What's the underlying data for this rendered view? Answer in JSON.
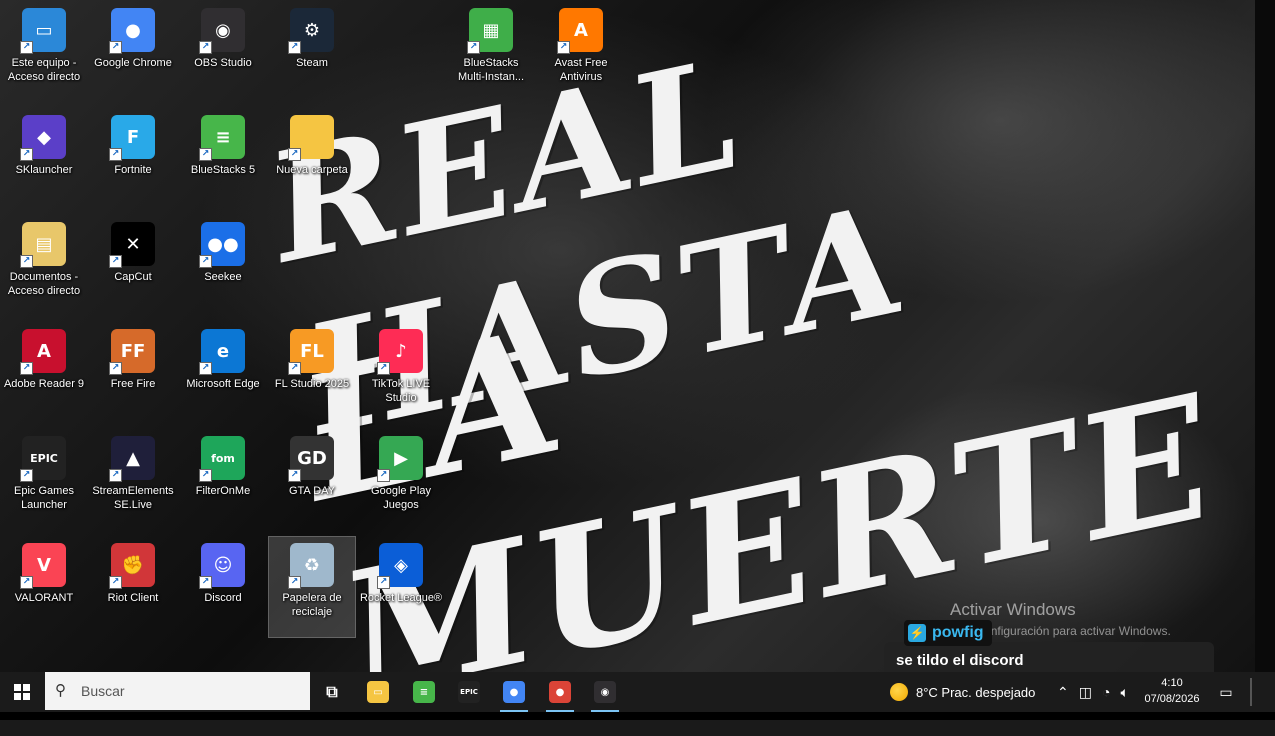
{
  "wallpaper": {
    "line1": "REAL HASTA",
    "line2": "LA MUERTE"
  },
  "desktop": {
    "icons": [
      {
        "label": "Este equipo -\nAcceso directo",
        "icon": "pc-icon",
        "bg": "#2b88d8",
        "glyph": "▭"
      },
      {
        "label": "Google Chrome",
        "icon": "chrome-icon",
        "bg": "#4285f4",
        "glyph": "●"
      },
      {
        "label": "OBS Studio",
        "icon": "obs-icon",
        "bg": "#302e31",
        "glyph": "◉"
      },
      {
        "label": "Steam",
        "icon": "steam-icon",
        "bg": "#1b2838",
        "glyph": "⚙"
      },
      {
        "label": "BlueStacks\nMulti-Instan...",
        "icon": "bluestacks-multi-icon",
        "bg": "#3fae49",
        "glyph": "▦"
      },
      {
        "label": "Avast Free\nAntivirus",
        "icon": "avast-icon",
        "bg": "#ff7800",
        "glyph": "A"
      },
      {
        "label": "SKlauncher",
        "icon": "sklauncher-icon",
        "bg": "#5b3fc8",
        "glyph": "◆"
      },
      {
        "label": "Fortnite",
        "icon": "fortnite-icon",
        "bg": "#29a9e8",
        "glyph": "F"
      },
      {
        "label": "BlueStacks 5",
        "icon": "bluestacks-icon",
        "bg": "#47b64a",
        "glyph": "≡"
      },
      {
        "label": "Nueva carpeta",
        "icon": "folder-icon",
        "bg": "#f5c542",
        "glyph": ""
      },
      {
        "label": "Documentos -\nAcceso directo",
        "icon": "documents-icon",
        "bg": "#e8c76a",
        "glyph": "▤"
      },
      {
        "label": "CapCut",
        "icon": "capcut-icon",
        "bg": "#000000",
        "glyph": "✕"
      },
      {
        "label": "Seekee",
        "icon": "seekee-icon",
        "bg": "#1b6fe8",
        "glyph": "●●"
      },
      {
        "label": "Adobe Reader 9",
        "icon": "adobe-reader-icon",
        "bg": "#c8102e",
        "glyph": "A"
      },
      {
        "label": "Free Fire",
        "icon": "free-fire-icon",
        "bg": "#d66a2a",
        "glyph": "FF"
      },
      {
        "label": "Microsoft Edge",
        "icon": "edge-icon",
        "bg": "#0c77d4",
        "glyph": "e"
      },
      {
        "label": "FL Studio 2025",
        "icon": "fl-studio-icon",
        "bg": "#f79a24",
        "glyph": "FL"
      },
      {
        "label": "TikTok LIVE\nStudio",
        "icon": "tiktok-live-icon",
        "bg": "#fe2c55",
        "glyph": "♪"
      },
      {
        "label": "Epic Games\nLauncher",
        "icon": "epic-games-icon",
        "bg": "#222222",
        "glyph": "EPIC"
      },
      {
        "label": "StreamElements\nSE.Live",
        "icon": "streamelements-icon",
        "bg": "#1f1f3a",
        "glyph": "▲"
      },
      {
        "label": "FilterOnMe",
        "icon": "filteronme-icon",
        "bg": "#1ea65a",
        "glyph": "fom"
      },
      {
        "label": "GTA DAY",
        "icon": "gta-day-icon",
        "bg": "#333333",
        "glyph": "GD"
      },
      {
        "label": "Google Play\nJuegos",
        "icon": "google-play-games-icon",
        "bg": "#35a853",
        "glyph": "▶"
      },
      {
        "label": "VALORANT",
        "icon": "valorant-icon",
        "bg": "#fa4454",
        "glyph": "V"
      },
      {
        "label": "Riot Client",
        "icon": "riot-client-icon",
        "bg": "#d13639",
        "glyph": "✊"
      },
      {
        "label": "Discord",
        "icon": "discord-icon",
        "bg": "#5865f2",
        "glyph": "☺"
      },
      {
        "label": "Papelera de\nreciclaje",
        "icon": "recycle-bin-icon",
        "bg": "#9fb8cc",
        "glyph": "♻"
      },
      {
        "label": "Rocket League®",
        "icon": "rocket-league-icon",
        "bg": "#0b5ed7",
        "glyph": "◈"
      }
    ]
  },
  "watermark": {
    "title": "Activar Windows",
    "subtitle": "Ve a Configuración para activar Windows."
  },
  "chat": {
    "username": "powfig",
    "message": "se tildo el discord"
  },
  "taskbar": {
    "search_placeholder": "Buscar",
    "apps": [
      {
        "name": "task-view-icon",
        "glyph": "⧉",
        "bg": "transparent"
      },
      {
        "name": "file-explorer-icon",
        "glyph": "▭",
        "bg": "#f5c542"
      },
      {
        "name": "bluestacks-taskbar-icon",
        "glyph": "≡",
        "bg": "#47b64a"
      },
      {
        "name": "epic-games-taskbar-icon",
        "glyph": "EPIC",
        "bg": "#222222"
      },
      {
        "name": "chrome-taskbar-icon",
        "glyph": "●",
        "bg": "#4285f4"
      },
      {
        "name": "chrome-profile-taskbar-icon",
        "glyph": "●",
        "bg": "#db4437"
      },
      {
        "name": "obs-taskbar-icon",
        "glyph": "◉",
        "bg": "#302e31"
      }
    ],
    "weather": "8°C  Prac. despejado",
    "time": "4:10",
    "date": "07/08/2026"
  }
}
